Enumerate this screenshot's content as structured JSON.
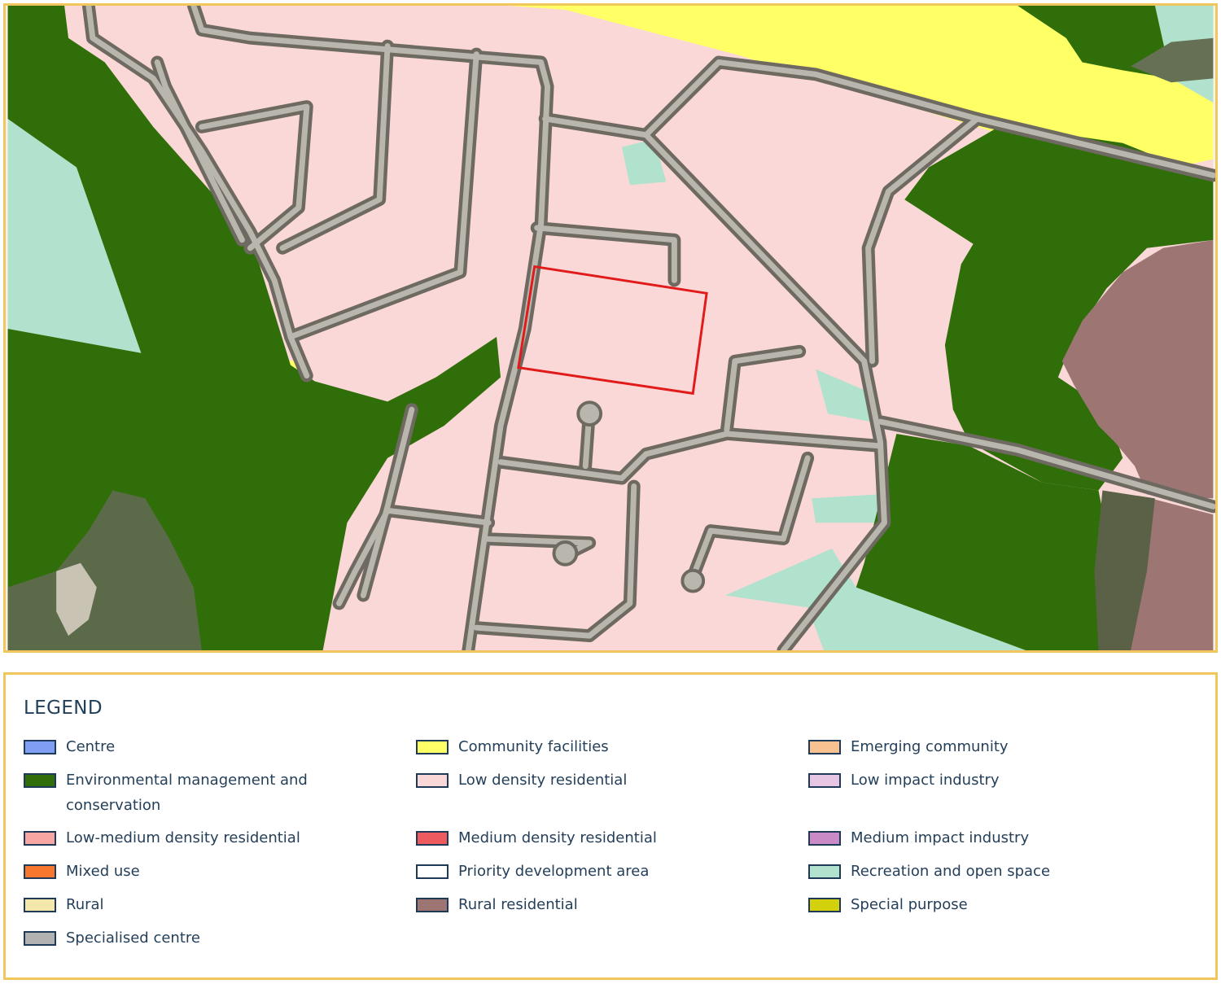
{
  "legend": {
    "title": "LEGEND",
    "items": [
      {
        "label": "Centre",
        "color": "#7f9ff4"
      },
      {
        "label": "Community facilities",
        "color": "#ffff66"
      },
      {
        "label": "Emerging community",
        "color": "#f8c18f"
      },
      {
        "label": "Environmental management and conservation",
        "color": "#2f6e08"
      },
      {
        "label": "Low density residential",
        "color": "#fbd8d8"
      },
      {
        "label": "Low impact industry",
        "color": "#e7c6e4"
      },
      {
        "label": "Low-medium density residential",
        "color": "#f7a6a2"
      },
      {
        "label": "Medium density residential",
        "color": "#ee5b5f"
      },
      {
        "label": "Medium impact industry",
        "color": "#c98ac6"
      },
      {
        "label": "Mixed use",
        "color": "#f8772e"
      },
      {
        "label": "Priority development area",
        "color": "#ffffff"
      },
      {
        "label": "Recreation and open space",
        "color": "#b1e2cd"
      },
      {
        "label": "Rural",
        "color": "#f3e7aa"
      },
      {
        "label": "Rural residential",
        "color": "#9d7674"
      },
      {
        "label": "Special purpose",
        "color": "#d3d10c"
      },
      {
        "label": "Specialised centre",
        "color": "#b2b2b2"
      }
    ]
  },
  "map": {
    "zones": {
      "environmental": "#2f6e08",
      "community": "#ffff66",
      "low_density_residential": "#fbd8d8",
      "recreation": "#b1e2cd",
      "rural_residential": "#9d7674"
    },
    "site_outline_color": "#e11a1a",
    "frame_color": "#f1c75d"
  }
}
